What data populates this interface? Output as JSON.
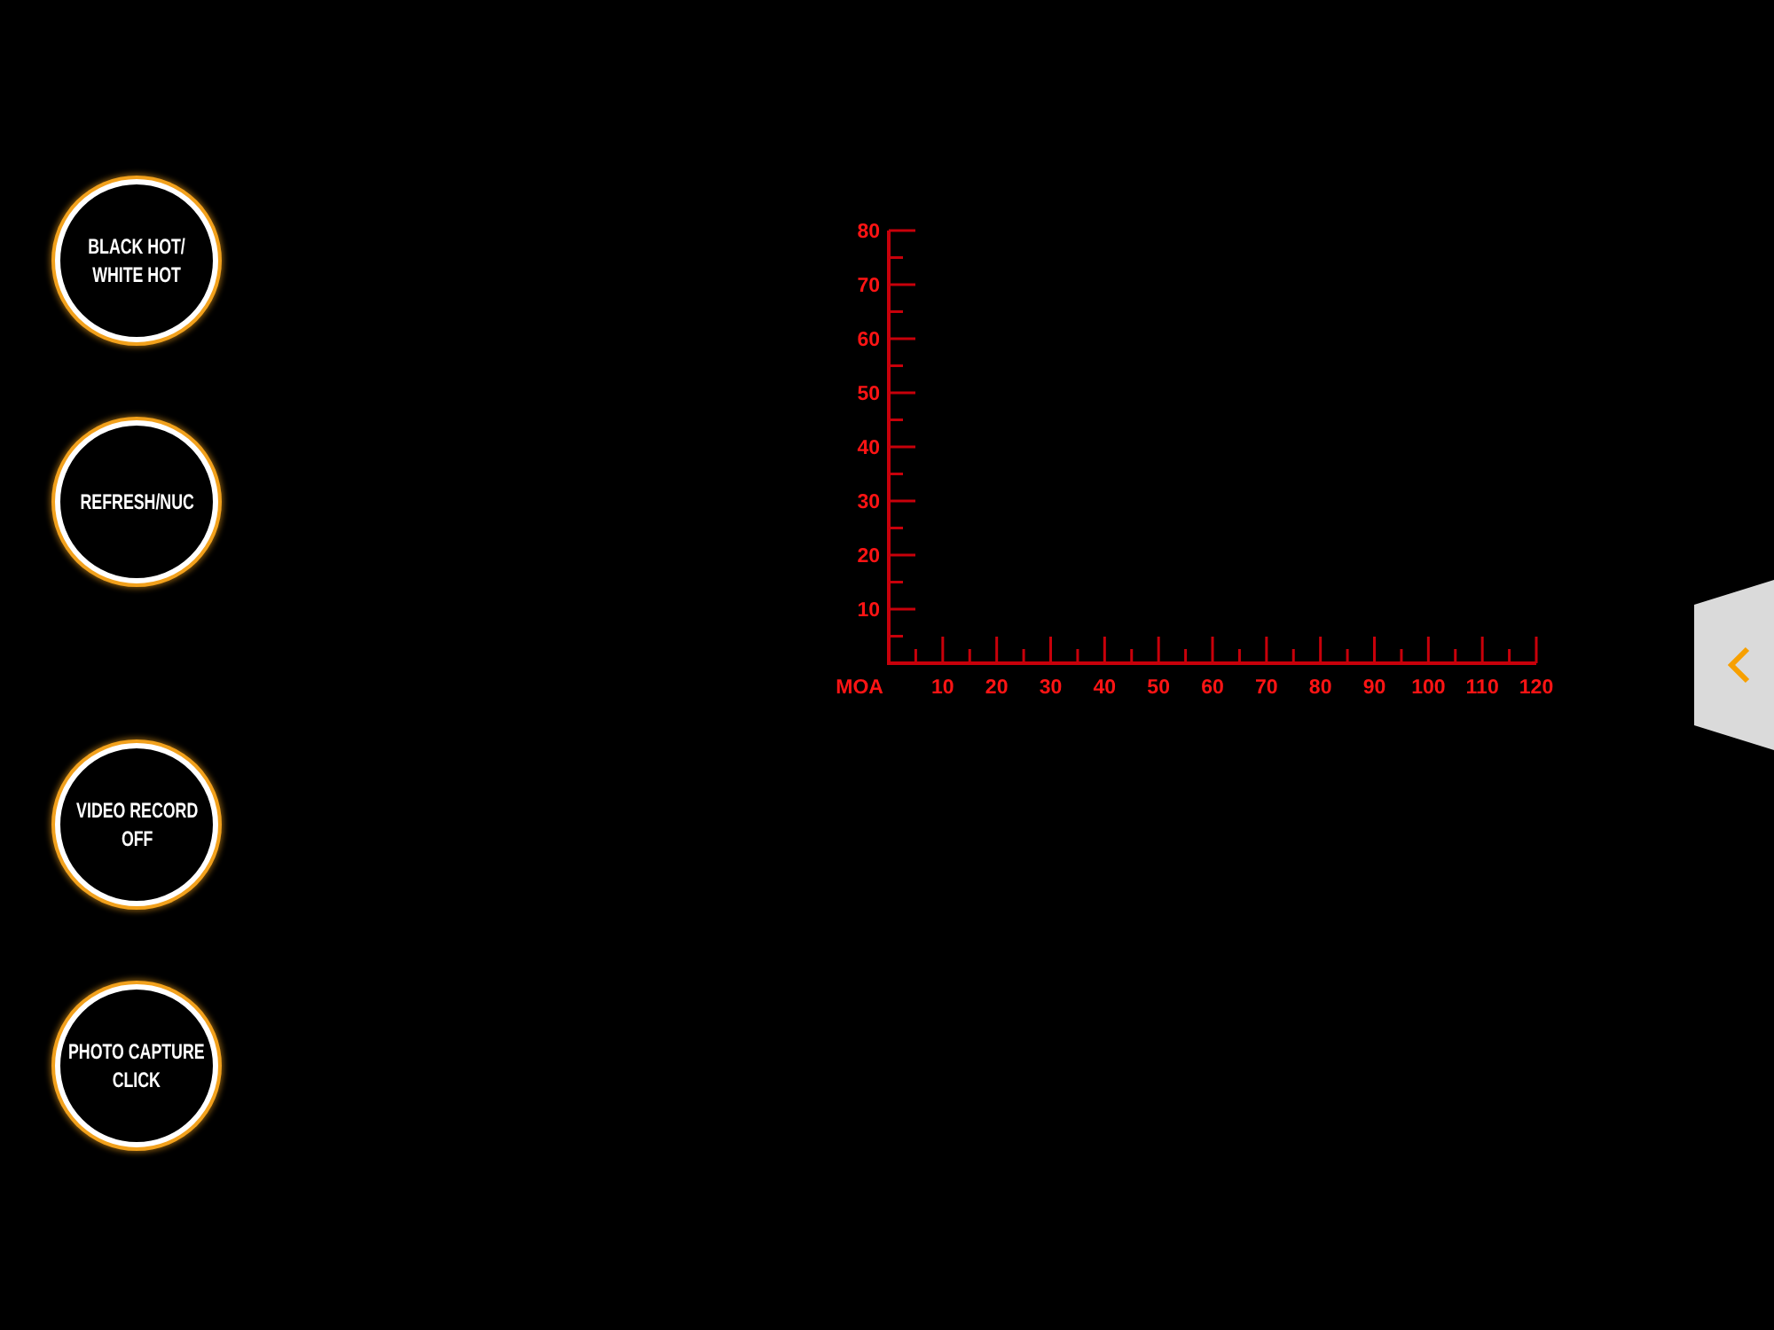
{
  "side_buttons": [
    {
      "label": "BLACK HOT/\nWHITE HOT"
    },
    {
      "label": "REFRESH/NUC"
    },
    {
      "label": "VIDEO RECORD\nOFF"
    },
    {
      "label": "PHOTO CAPTURE\nCLICK"
    }
  ],
  "reticle": {
    "chart_data": {
      "type": "line",
      "xlabel": "MOA",
      "xlim": [
        0,
        120
      ],
      "ylim": [
        0,
        80
      ],
      "xticks": [
        10,
        20,
        30,
        40,
        50,
        60,
        70,
        80,
        90,
        100,
        110,
        120
      ],
      "yticks": [
        10,
        20,
        30,
        40,
        50,
        60,
        70,
        80
      ]
    }
  }
}
